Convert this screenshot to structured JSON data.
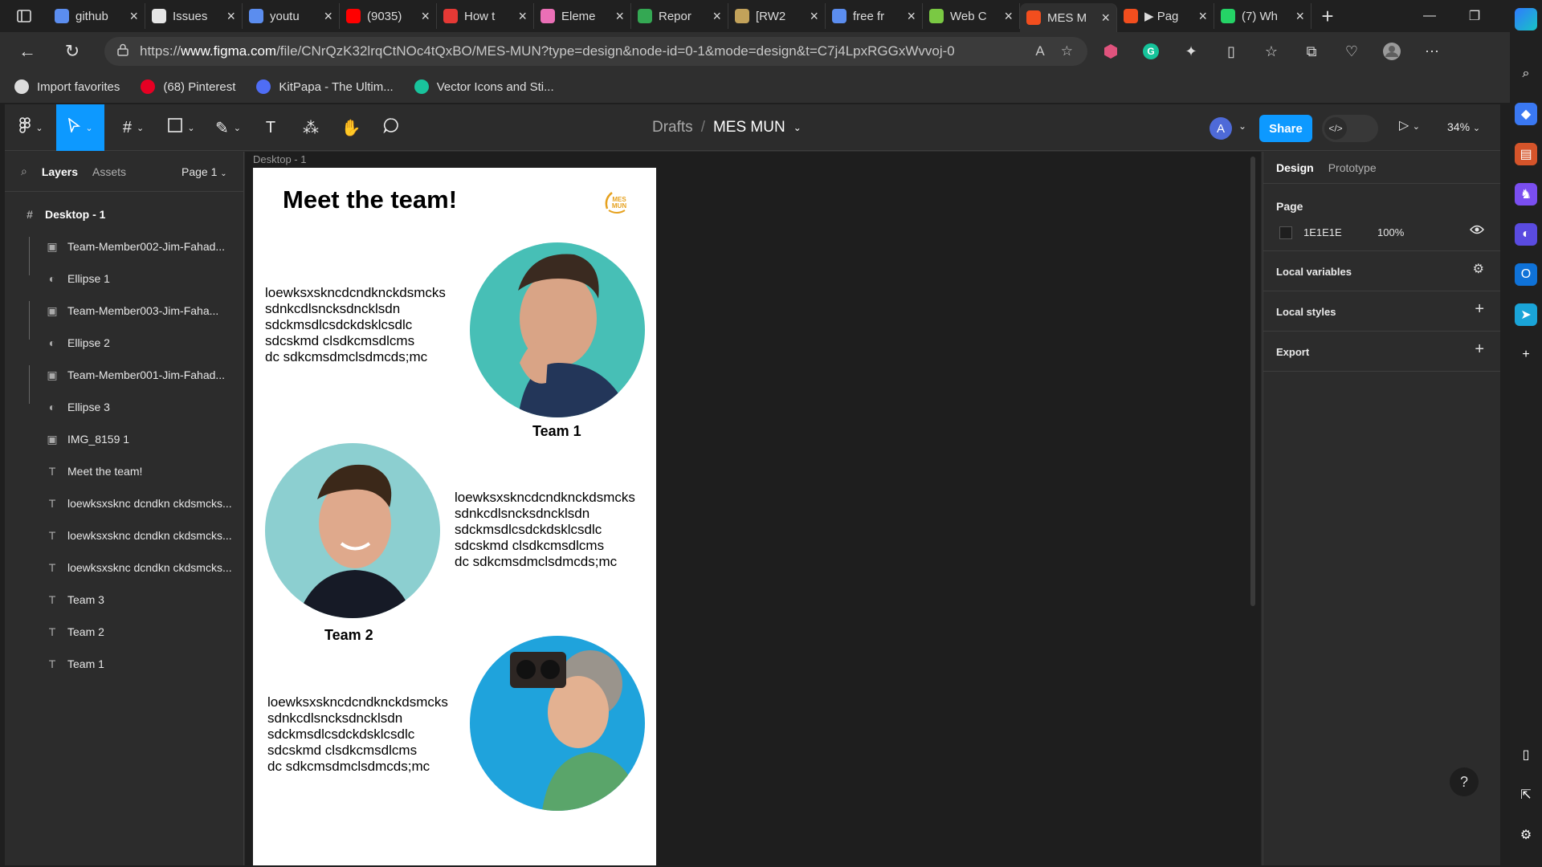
{
  "browser": {
    "tabs": [
      {
        "label": "github",
        "icon": "search-icon",
        "color": "#5b8def"
      },
      {
        "label": "Issues",
        "icon": "github-icon",
        "color": "#e6e6e6"
      },
      {
        "label": "youtu",
        "icon": "search-icon",
        "color": "#5b8def"
      },
      {
        "label": "(9035)",
        "icon": "youtube-icon",
        "color": "#ff0000"
      },
      {
        "label": "How t",
        "icon": "pinwheel-icon",
        "color": "#e53935"
      },
      {
        "label": "Eleme",
        "icon": "elementor-icon",
        "color": "#ea6fb6"
      },
      {
        "label": "Repor",
        "icon": "drive-icon",
        "color": "#34a853"
      },
      {
        "label": "[RW2",
        "icon": "envelope-icon",
        "color": "#c2a25a"
      },
      {
        "label": "free fr",
        "icon": "search-icon",
        "color": "#5b8def"
      },
      {
        "label": "Web C",
        "icon": "leaf-icon",
        "color": "#7ac943"
      },
      {
        "label": "MES M",
        "icon": "figma-icon",
        "color": "#f24e1e"
      },
      {
        "label": "▶ Pag",
        "icon": "figma-icon",
        "color": "#f24e1e"
      },
      {
        "label": "(7) Wh",
        "icon": "whatsapp-icon",
        "color": "#25d366"
      }
    ],
    "url_prefix": "https://",
    "url_domain": "www.figma.com",
    "url_rest": "/file/CNrQzK32lrqCtNOc4tQxBO/MES-MUN?type=design&node-id=0-1&mode=design&t=C7j4LpxRGGxWvvoj-0",
    "favorites": [
      {
        "label": "Import favorites",
        "icon": "import-icon",
        "color": "#dcdcdc"
      },
      {
        "label": "(68) Pinterest",
        "icon": "pinterest-icon",
        "color": "#e60023"
      },
      {
        "label": "KitPapa - The Ultim...",
        "icon": "kitpapa-icon",
        "color": "#4f6df5"
      },
      {
        "label": "Vector Icons and Sti...",
        "icon": "vector-icon",
        "color": "#19c39c"
      }
    ]
  },
  "figma": {
    "breadcrumb": {
      "folder": "Drafts",
      "separator": "/",
      "file": "MES MUN"
    },
    "avatar_letter": "A",
    "share_label": "Share",
    "zoom": "34%",
    "left_tabs": {
      "layers": "Layers",
      "assets": "Assets",
      "page": "Page 1"
    },
    "layers": [
      {
        "name": "Desktop - 1",
        "icon": "frame-icon",
        "kind": "frame"
      },
      {
        "name": "Team-Member002-Jim-Fahad...",
        "icon": "image-icon",
        "kind": "child"
      },
      {
        "name": "Ellipse 1",
        "icon": "mask-icon",
        "kind": "child"
      },
      {
        "name": "Team-Member003-Jim-Faha...",
        "icon": "image-icon",
        "kind": "child"
      },
      {
        "name": "Ellipse 2",
        "icon": "mask-icon",
        "kind": "child"
      },
      {
        "name": "Team-Member001-Jim-Fahad...",
        "icon": "image-icon",
        "kind": "child"
      },
      {
        "name": "Ellipse 3",
        "icon": "mask-icon",
        "kind": "child"
      },
      {
        "name": "IMG_8159 1",
        "icon": "image-icon",
        "kind": "child"
      },
      {
        "name": "Meet the team!",
        "icon": "text-icon",
        "kind": "child"
      },
      {
        "name": "loewksxsknc dcndkn ckdsmcks...",
        "icon": "text-icon",
        "kind": "child"
      },
      {
        "name": "loewksxsknc dcndkn ckdsmcks...",
        "icon": "text-icon",
        "kind": "child"
      },
      {
        "name": "loewksxsknc dcndkn ckdsmcks...",
        "icon": "text-icon",
        "kind": "child"
      },
      {
        "name": "Team 3",
        "icon": "text-icon",
        "kind": "child"
      },
      {
        "name": "Team 2",
        "icon": "text-icon",
        "kind": "child"
      },
      {
        "name": "Team 1",
        "icon": "text-icon",
        "kind": "child"
      }
    ],
    "canvas": {
      "frame_label": "Desktop - 1",
      "title": "Meet the team!",
      "logo_text": "MES MUN",
      "body_text": "loewksxskncdcndknckdsmcks\nsdnkcdlsncksdncklsdn\nsdckmsdlcsdckdsklcsdlc\nsdcskmd clsdkcmsdlcms\ndc sdkcmsdmclsdmcds;mc",
      "team1": "Team 1",
      "team2": "Team 2"
    },
    "right_tabs": {
      "design": "Design",
      "prototype": "Prototype"
    },
    "page_section": {
      "title": "Page",
      "color_hex": "1E1E1E",
      "opacity": "100%"
    },
    "local_variables": "Local variables",
    "local_styles": "Local styles",
    "export": "Export",
    "help": "?"
  },
  "colors": {
    "accent": "#0d99ff",
    "page_bg": "#1e1e1e"
  }
}
